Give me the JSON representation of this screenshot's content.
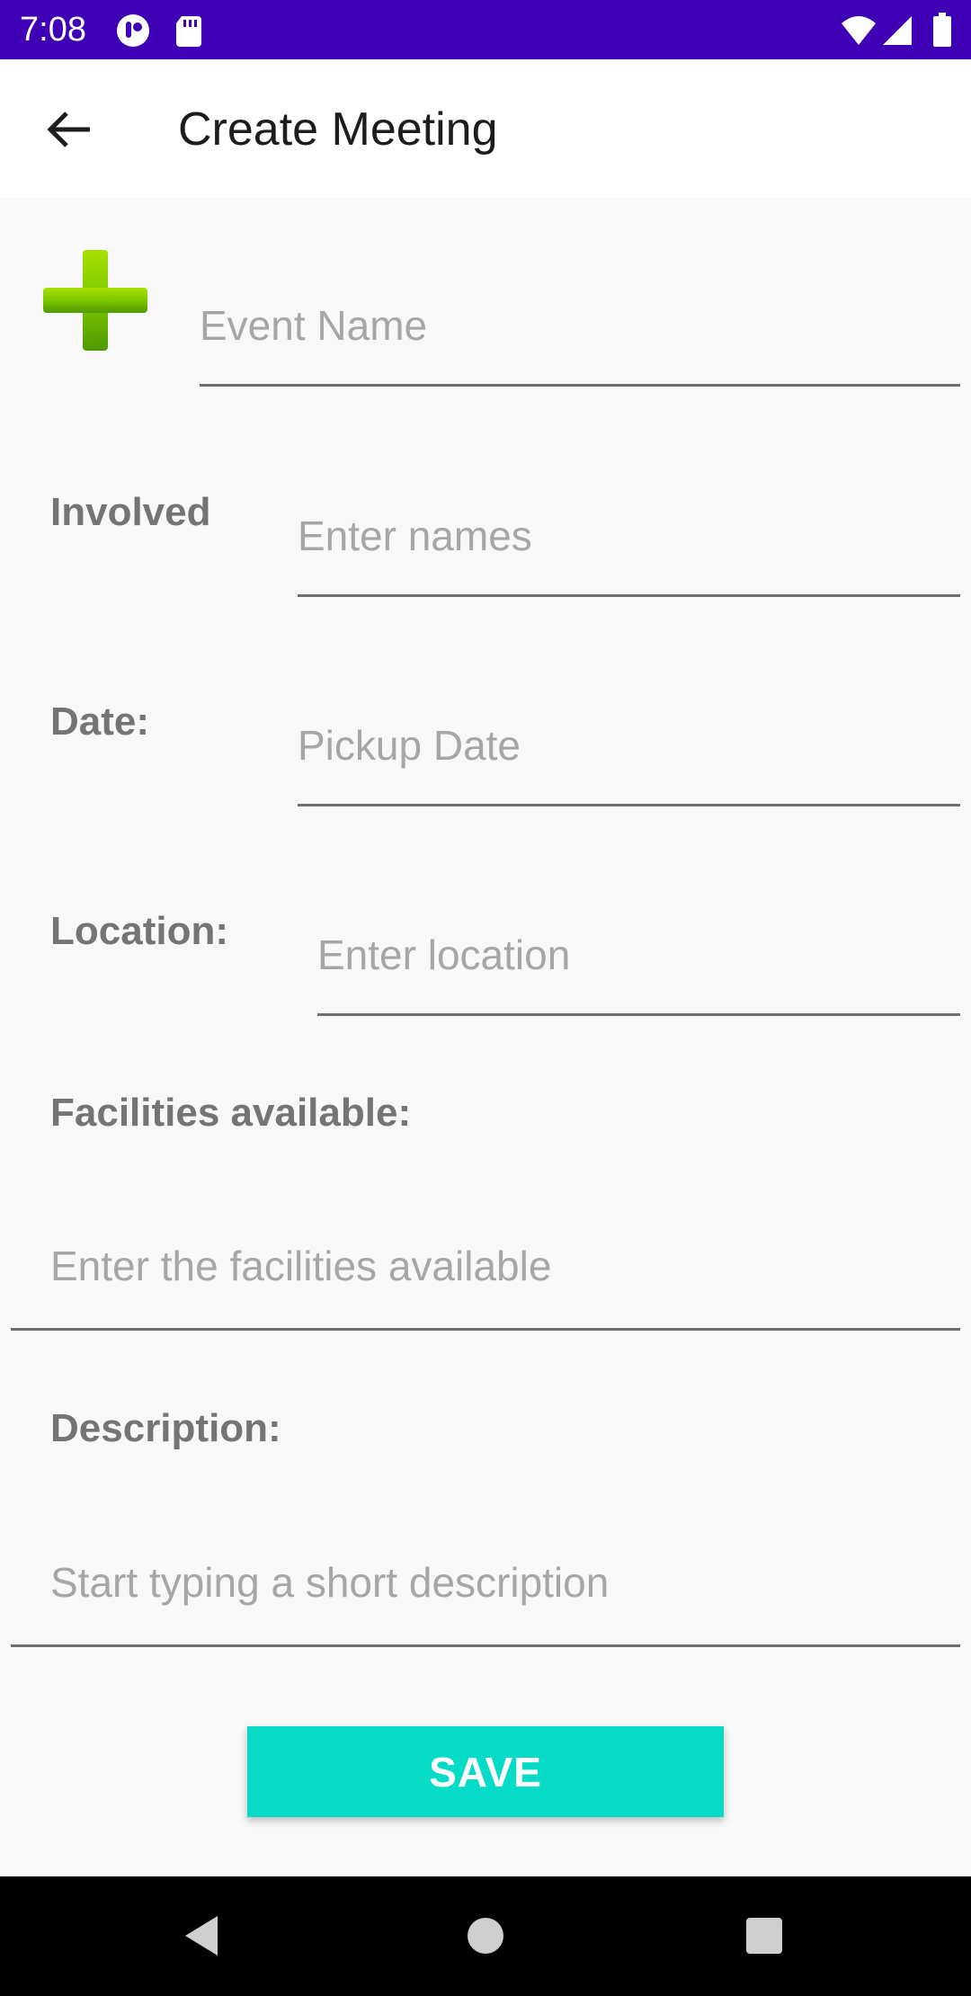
{
  "status_bar": {
    "time": "7:08",
    "icons": [
      "app-notification-icon",
      "sd-card-icon",
      "wifi-icon",
      "signal-icon",
      "battery-icon"
    ],
    "background_color": "#3f00b5"
  },
  "toolbar": {
    "title": "Create Meeting",
    "back_icon": "arrow-back-icon"
  },
  "form": {
    "event_name": {
      "icon": "green-plus-icon",
      "placeholder": "Event Name",
      "value": ""
    },
    "involved": {
      "label": "Involved",
      "placeholder": "Enter names",
      "value": ""
    },
    "date": {
      "label": "Date:",
      "placeholder": "Pickup Date",
      "value": ""
    },
    "location": {
      "label": "Location:",
      "placeholder": "Enter location",
      "value": ""
    },
    "facilities": {
      "label": "Facilities available:",
      "placeholder": "Enter the facilities available",
      "value": ""
    },
    "description": {
      "label": "Description:",
      "placeholder": "Start typing a short description",
      "value": ""
    }
  },
  "save_button": {
    "label": "SAVE",
    "color": "#05dbc7"
  },
  "nav_bar": {
    "buttons": [
      "back-triangle-icon",
      "home-circle-icon",
      "recents-square-icon"
    ]
  }
}
